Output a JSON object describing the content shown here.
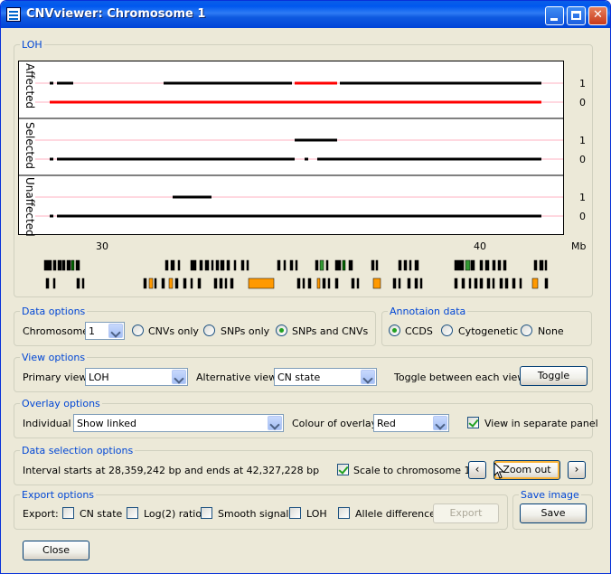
{
  "window": {
    "title": "CNVviewer: Chromosome 1"
  },
  "loh": {
    "group_label": "LOH",
    "panels": [
      {
        "label": "Affected",
        "y_top": "1",
        "y_bottom": "0"
      },
      {
        "label": "Selected",
        "y_top": "1",
        "y_bottom": "0"
      },
      {
        "label": "Unaffected",
        "y_top": "1",
        "y_bottom": "0"
      }
    ],
    "x_ticks": [
      "30",
      "40"
    ],
    "x_unit": "Mb"
  },
  "data_options": {
    "group_label": "Data options",
    "chromosome_label": "Chromosome",
    "chromosome_value": "1",
    "radios": [
      {
        "label": "CNVs only",
        "selected": false
      },
      {
        "label": "SNPs only",
        "selected": false
      },
      {
        "label": "SNPs and CNVs",
        "selected": true
      }
    ]
  },
  "annotation_data": {
    "group_label": "Annotaion data",
    "radios": [
      {
        "label": "CCDS",
        "selected": true
      },
      {
        "label": "Cytogenetic",
        "selected": false
      },
      {
        "label": "None",
        "selected": false
      }
    ]
  },
  "view_options": {
    "group_label": "View options",
    "primary_label": "Primary view",
    "primary_value": "LOH",
    "alternative_label": "Alternative view",
    "alternative_value": "CN state",
    "toggle_label": "Toggle between each view",
    "toggle_button": "Toggle"
  },
  "overlay_options": {
    "group_label": "Overlay options",
    "individual_label": "Individual",
    "individual_value": "Show linked",
    "colour_label": "Colour of overlay",
    "colour_value": "Red",
    "separate_panel_label": "View in separate panel",
    "separate_panel_checked": true
  },
  "data_selection": {
    "group_label": "Data selection options",
    "interval_text": "Interval starts at 28,359,242 bp and ends at 42,327,228 bp",
    "scale_label": "Scale to chromosome 1",
    "scale_checked": true,
    "prev_icon": "‹",
    "next_icon": "›",
    "zoom_out_button": "Zoom out"
  },
  "export_options": {
    "group_label": "Export options",
    "export_label": "Export:",
    "checks": [
      {
        "label": "CN state",
        "checked": false
      },
      {
        "label": "Log(2) ratio",
        "checked": false
      },
      {
        "label": "Smooth signal",
        "checked": false
      },
      {
        "label": "LOH",
        "checked": false
      },
      {
        "label": "Allele difference",
        "checked": false
      }
    ],
    "export_button": "Export"
  },
  "save_image": {
    "group_label": "Save image",
    "save_button": "Save"
  },
  "close_button": "Close",
  "colors": {
    "loh_segment": "#ff0000",
    "normal_segment": "#000000",
    "baseline": "#ffb0c0",
    "accent": "#0046d5"
  },
  "icons": {
    "app": "cnv-app-icon",
    "minimize": "minimize-icon",
    "maximize": "maximize-icon",
    "close": "close-icon",
    "cursor": "mouse-pointer-icon"
  }
}
